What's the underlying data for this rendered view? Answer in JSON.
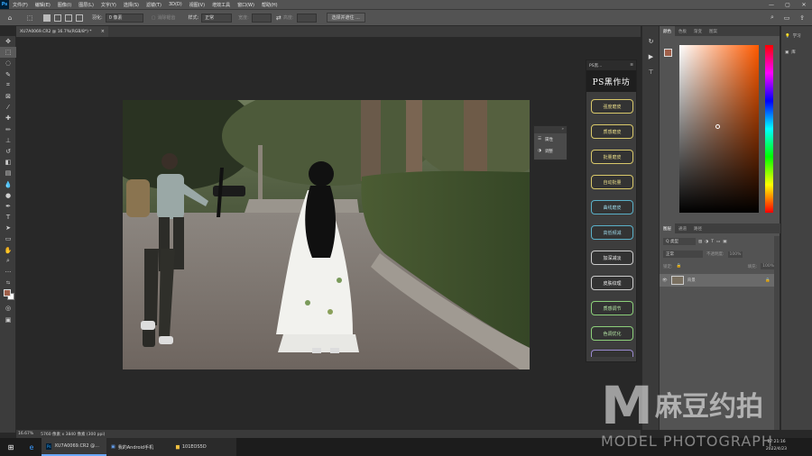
{
  "app": {
    "logo": "Ps"
  },
  "menu": [
    "文件(F)",
    "编辑(E)",
    "图像(I)",
    "图层(L)",
    "文字(Y)",
    "选择(S)",
    "滤镜(T)",
    "3D(D)",
    "视图(V)",
    "增效工具",
    "窗口(W)",
    "帮助(H)"
  ],
  "window_controls": {
    "minimize": "—",
    "maximize": "▢",
    "close": "✕"
  },
  "options": {
    "feather_label": "羽化:",
    "feather_value": "0 像素",
    "antialias_label": "消除锯齿",
    "style_label": "样式:",
    "style_value": "正常",
    "width_label": "宽度:",
    "height_label": "高度:",
    "select_mask_button": "选择并遮住 ..."
  },
  "document": {
    "tab_title": "XU7A0069.CR2 @ 16.7%(RGB/8*) *",
    "close": "×"
  },
  "status": {
    "zoom": "16.67%",
    "size": "5760 像素 x 3840 像素 (300 ppi)"
  },
  "plugin": {
    "title": "PS黑...",
    "logo": "PS黑作坊",
    "buttons": [
      "强度磨皮",
      "质感磨皮",
      "批量磨皮",
      "自动批量",
      "曲线磨皮",
      "高低频减",
      "加深减淡",
      "皮肤纹理",
      "质感调节",
      "色调优化"
    ]
  },
  "properties": {
    "items": [
      "属性",
      "调整"
    ]
  },
  "color_panel": {
    "tabs": [
      "颜色",
      "色板",
      "渐变",
      "图案"
    ]
  },
  "layers_panel": {
    "tabs": [
      "图层",
      "通道",
      "路径"
    ],
    "kind": "Q 类型",
    "blend": "正常",
    "opacity_label": "不透明度:",
    "opacity_value": "100%",
    "lock_label": "锁定:",
    "fill_label": "填充:",
    "fill_value": "100%",
    "layer_name": "背景"
  },
  "far_strip": {
    "items": [
      "学习",
      "库"
    ]
  },
  "taskbar": {
    "items": [
      "XU7A0069.CR2 @...",
      "我的Android手机",
      "101EOS5D"
    ],
    "time": "17:21:16",
    "date": "2022/4/23"
  },
  "watermark": {
    "letter": "M",
    "text": "麻豆约拍",
    "sub": "MODEL PHOTOGRAPH"
  },
  "colors": {
    "accent": "#31a8ff",
    "fg_swatch": "#a0604a",
    "plugin_border": "#d9c86a"
  }
}
